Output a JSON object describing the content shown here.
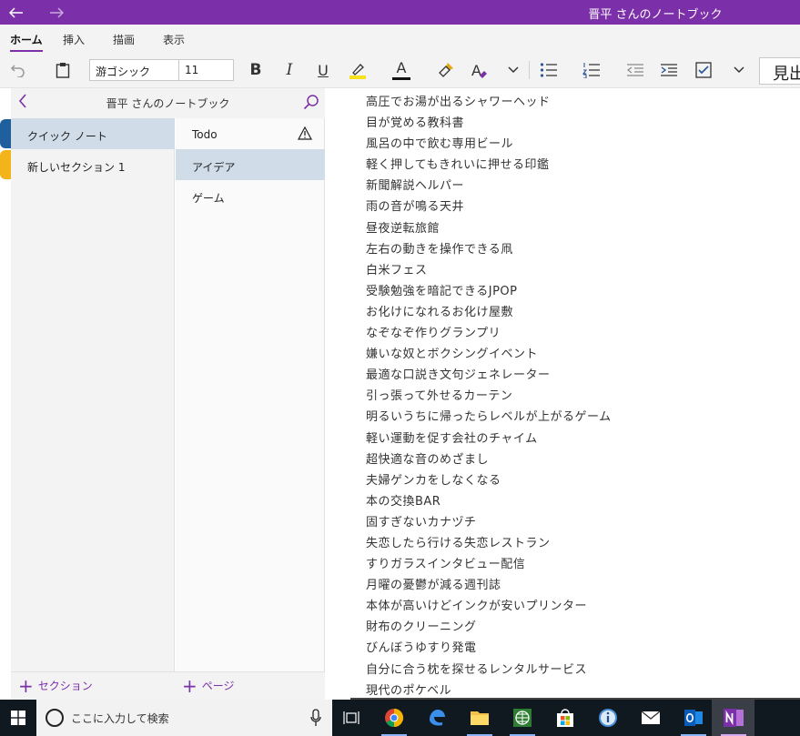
{
  "titlebar": {
    "title": "晋平 さんのノートブック",
    "back_icon": "arrow-left-icon",
    "forward_icon": "arrow-right-icon",
    "background": "#7b2fa8"
  },
  "ribbon": {
    "tabs": [
      {
        "label": "ホーム",
        "active": true
      },
      {
        "label": "挿入",
        "active": false
      },
      {
        "label": "描画",
        "active": false
      },
      {
        "label": "表示",
        "active": false
      }
    ]
  },
  "toolbar": {
    "font_name": "游ゴシック",
    "font_size": "11",
    "bold_label": "B",
    "italic_label": "I",
    "underline_label": "U",
    "font_color_label": "A",
    "clear_format_label": "A",
    "heading_label": "見出",
    "highlight_color": "#f7e11d",
    "font_color": "#111111"
  },
  "navigator": {
    "notebook_title": "晋平 さんのノートブック",
    "sections": [
      {
        "label": "クイック ノート",
        "color": "#1f5f9e",
        "selected": true
      },
      {
        "label": "新しいセクション 1",
        "color": "#f2b418",
        "selected": false
      }
    ],
    "pages": [
      {
        "label": "Todo",
        "selected": false,
        "warning": true
      },
      {
        "label": "アイデア",
        "selected": true,
        "warning": false
      },
      {
        "label": "ゲーム",
        "selected": false,
        "warning": false
      }
    ],
    "add_section_label": "セクション",
    "add_page_label": "ページ",
    "accent": "#7b2fa8"
  },
  "content": {
    "lines": [
      "高圧でお湯が出るシャワーヘッド",
      "目が覚める教科書",
      "風呂の中で飲む専用ビール",
      "軽く押してもきれいに押せる印鑑",
      "新聞解説ヘルパー",
      "雨の音が鳴る天井",
      "昼夜逆転旅館",
      "左右の動きを操作できる凧",
      "白米フェス",
      "受験勉強を暗記できるJPOP",
      "お化けになれるお化け屋敷",
      "なぞなぞ作りグランプリ",
      "嫌いな奴とボクシングイベント",
      "最適な口説き文句ジェネレーター",
      "引っ張って外せるカーテン",
      "明るいうちに帰ったらレベルが上がるゲーム",
      "軽い運動を促す会社のチャイム",
      "超快適な音のめざまし",
      "夫婦ゲンカをしなくなる",
      "本の交換BAR",
      "固すぎないカナヅチ",
      "失恋したら行ける失恋レストラン",
      "すりガラスインタビュー配信",
      "月曜の憂鬱が減る週刊誌",
      "本体が高いけどインクが安いプリンター",
      "財布のクリーニング",
      "びんぼうゆすり発電",
      "自分に合う枕を探せるレンタルサービス",
      "現代のポケベル"
    ]
  },
  "taskbar": {
    "search_placeholder": "ここに入力して検索",
    "icons": [
      "windows-start-icon",
      "cortana-icon",
      "microphone-icon",
      "task-view-icon",
      "chrome-icon",
      "edge-icon",
      "file-explorer-icon",
      "globe-app-icon",
      "store-icon",
      "info-app-icon",
      "mail-icon",
      "outlook-icon",
      "onenote-icon"
    ]
  }
}
